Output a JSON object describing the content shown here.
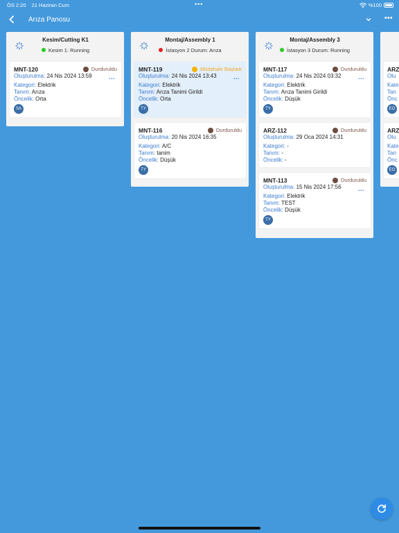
{
  "status_bar": {
    "time": "ÖS 2:20",
    "date": "21 Haziran Cum",
    "dots": "•••",
    "battery": "%100"
  },
  "nav": {
    "title": "Arıza Panosu",
    "more": "•••"
  },
  "columns": [
    {
      "title": "Kesim/Cutting K1",
      "status_text": "Kesim 1: Running",
      "status_color": "#22cc22",
      "cards": [
        {
          "id": "MNT-120",
          "badge": "Durduruldu",
          "created_label": "Oluşturulma:",
          "created": "24 Nis 2024 13:59",
          "category_label": "Kategori:",
          "category": "Elektrik",
          "desc_label": "Tanım:",
          "desc": "Arıza",
          "priority_label": "Öncelik:",
          "priority": "Orta",
          "avatar": "SA"
        }
      ]
    },
    {
      "title": "Montaj/Assembly 1",
      "status_text": "İstasyon 2 Durum: Arıza",
      "status_color": "#e52020",
      "cards": [
        {
          "id": "MNT-119",
          "badge": "Müdahale Başladı",
          "created_label": "Oluşturulma:",
          "created": "24 Nis 2024 13:43",
          "category_label": "Kategori:",
          "category": "Elektrik",
          "desc_label": "Tanım:",
          "desc": "Arıza Tanimi Girildi",
          "priority_label": "Öncelik:",
          "priority": "Orta",
          "avatar": "TY"
        },
        {
          "id": "MNT-116",
          "badge": "Durduruldu",
          "created_label": "Oluşturulma:",
          "created": "20 Nis 2024 16:35",
          "category_label": "Kategori:",
          "category": "A/C",
          "desc_label": "Tanım:",
          "desc": "tanim",
          "priority_label": "Öncelik:",
          "priority": "Düşük",
          "avatar": "TY"
        }
      ]
    },
    {
      "title": "Montaj/Assembly 3",
      "status_text": "İstasyon 3 Durum: Running",
      "status_color": "#22cc22",
      "cards": [
        {
          "id": "MNT-117",
          "badge": "Durduruldu",
          "created_label": "Oluşturulma:",
          "created": "24 Nis 2024 03:32",
          "category_label": "Kategori:",
          "category": "Elektrik",
          "desc_label": "Tanım:",
          "desc": "Arıza Tanimi Girildi",
          "priority_label": "Öncelik:",
          "priority": "Düşük",
          "avatar": "TY"
        },
        {
          "id": "ARZ-112",
          "badge": "Durduruldu",
          "created_label": "Oluşturulma:",
          "created": "29 Oca 2024 14:31",
          "category_label": "Kategori:",
          "category": "-",
          "desc_label": "Tanım:",
          "desc": "-",
          "priority_label": "Öncelik:",
          "priority": "-",
          "avatar": ""
        },
        {
          "id": "MNT-113",
          "badge": "Durduruldu",
          "created_label": "Oluşturulma:",
          "created": "15 Nis 2024 17:56",
          "category_label": "Kategori:",
          "category": "Elektrik",
          "desc_label": "Tanım:",
          "desc": "TEST",
          "priority_label": "Öncelik:",
          "priority": "Düşük",
          "avatar": "TY"
        }
      ]
    },
    {
      "title": "",
      "status_text": "",
      "status_color": "",
      "cards": [
        {
          "id": "ARZ",
          "created_label": "Olu",
          "category_label": "Kate",
          "desc_label": "Tan",
          "priority_label": "Önc",
          "avatar": "EO"
        },
        {
          "id": "ARZ",
          "created_label": "Olu",
          "category_label": "Kate",
          "desc_label": "Tan",
          "priority_label": "Önc",
          "avatar": "EO"
        }
      ]
    }
  ],
  "colors": {
    "background": "#4499dc",
    "accent": "#3b7ccf",
    "paused": "#6d4c41",
    "intervention": "#f5b400"
  },
  "icons": {
    "back": "chevron-left-icon",
    "chevron": "chevron-down-icon",
    "refresh": "refresh-icon",
    "column": "spinner-icon"
  }
}
